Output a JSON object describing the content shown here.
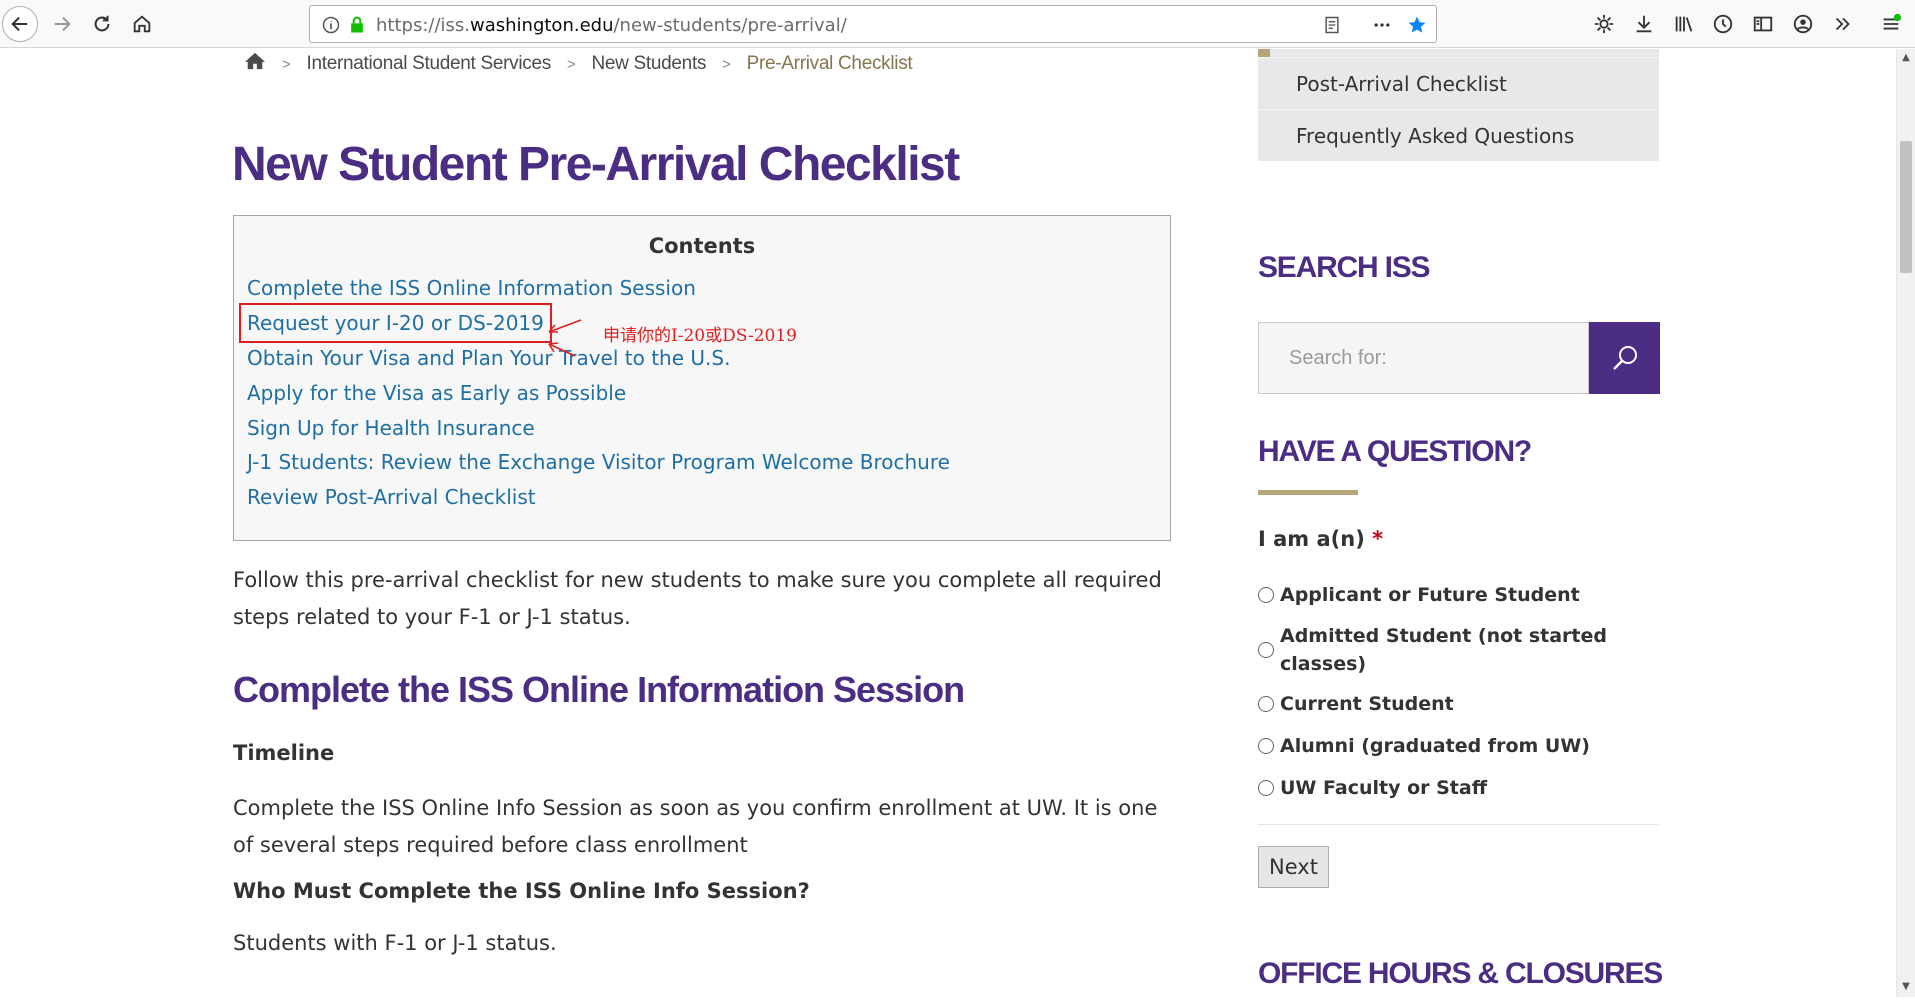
{
  "browser": {
    "url_prefix": "https://iss.",
    "url_domain": "washington.edu",
    "url_path": "/new-students/pre-arrival/"
  },
  "breadcrumb": {
    "items": [
      "International Student Services",
      "New Students"
    ],
    "current": "Pre-Arrival Checklist",
    "separator": ">"
  },
  "page_title": "New Student Pre-Arrival Checklist",
  "contents": {
    "title": "Contents",
    "items": [
      "Complete the ISS Online Information Session",
      "Request your I-20 or DS-2019",
      "Obtain Your Visa and Plan Your Travel to the U.S.",
      "Apply for the Visa as Early as Possible",
      "Sign Up for Health Insurance",
      "J-1 Students: Review the Exchange Visitor Program Welcome Brochure",
      "Review Post-Arrival Checklist"
    ]
  },
  "annotation": "申请你的I-20或DS-2019",
  "intro": "Follow this pre-arrival checklist for new students to make sure you complete all required steps related to your F-1 or J-1 status.",
  "section1": {
    "heading": "Complete the ISS Online Information Session",
    "timeline_label": "Timeline",
    "timeline_text": "Complete the ISS Online Info Session as soon as you confirm enrollment at UW. It is one of several steps required before class enrollment",
    "who_label": "Who Must Complete the ISS Online Info Session?",
    "who_text": "Students with F-1 or J-1 status."
  },
  "sidebar": {
    "nav_items": [
      "Post-Arrival Checklist",
      "Frequently Asked Questions"
    ],
    "search_heading": "SEARCH ISS",
    "search_placeholder": "Search for:",
    "question_heading": "HAVE A QUESTION?",
    "iam_label": "I am a(n)",
    "required_mark": "*",
    "options": [
      "Applicant or Future Student",
      "Admitted Student (not started classes)",
      "Current Student",
      "Alumni (graduated from UW)",
      "UW Faculty or Staff"
    ],
    "next_label": "Next",
    "office_heading": "OFFICE HOURS & CLOSURES"
  },
  "colors": {
    "uw_purple": "#4b2e83",
    "uw_gold": "#b7a57a",
    "link_blue": "#1f6fa3",
    "annotation_red": "#e02020"
  }
}
